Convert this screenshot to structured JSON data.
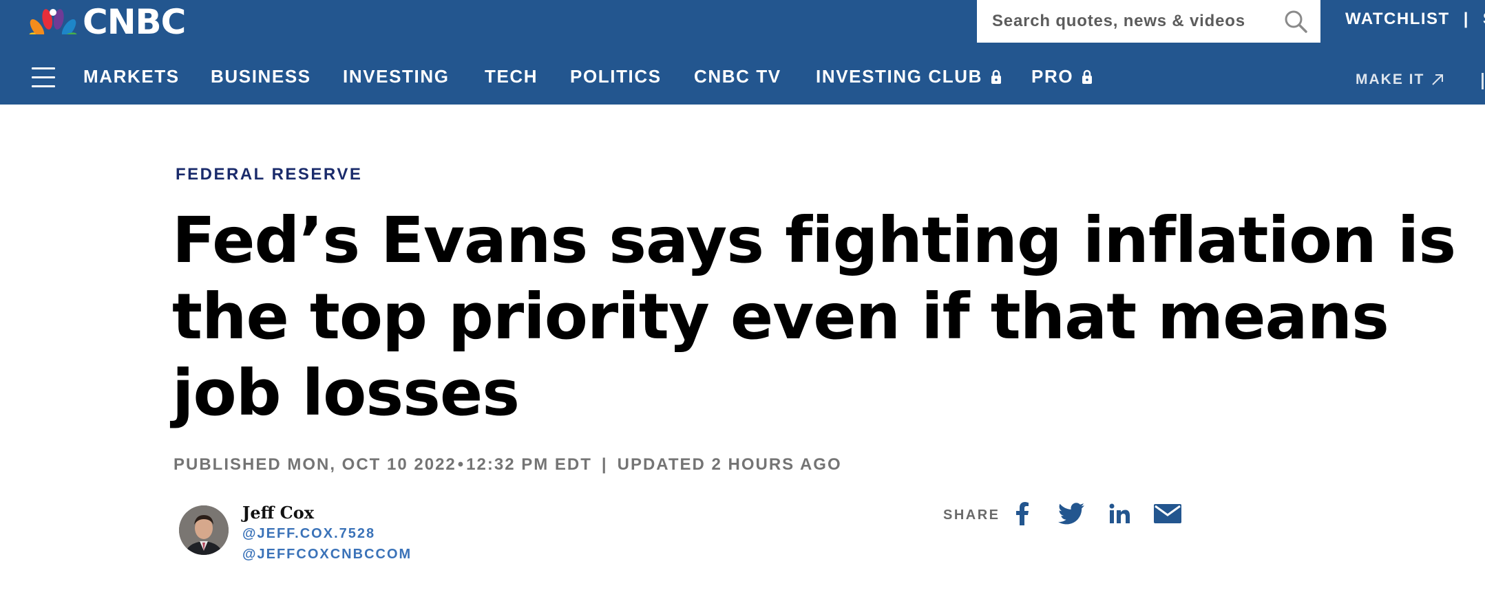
{
  "header": {
    "logo_text": "CNBC",
    "search_placeholder": "Search quotes, news & videos",
    "watchlist_label": "WATCHLIST",
    "separator": "|",
    "cut_off_label": "S",
    "nav_items": [
      {
        "label": "MARKETS"
      },
      {
        "label": "BUSINESS"
      },
      {
        "label": "INVESTING"
      },
      {
        "label": "TECH"
      },
      {
        "label": "POLITICS"
      },
      {
        "label": "CNBC TV"
      },
      {
        "label": "INVESTING CLUB",
        "icon": "lock-icon"
      },
      {
        "label": "PRO",
        "icon": "lock-icon"
      }
    ],
    "make_it_label": "MAKE IT",
    "make_it_icon": "external-arrow-icon"
  },
  "article": {
    "eyebrow": "FEDERAL RESERVE",
    "headline": "Fed’s Evans says fighting inflation is the top priority even if that means job losses",
    "published": "PUBLISHED MON, OCT 10 2022",
    "dot": "•",
    "time": "12:32 PM EDT",
    "separator": "|",
    "updated": "UPDATED 2 HOURS AGO"
  },
  "author": {
    "name": "Jeff Cox",
    "handle_1": "@JEFF.COX.7528",
    "handle_2": "@JEFFCOXCNBCCOM"
  },
  "share": {
    "label": "SHARE",
    "icons": [
      "facebook-icon",
      "twitter-icon",
      "linkedin-icon",
      "email-icon"
    ]
  },
  "colors": {
    "header_bg": "#23568f",
    "eyebrow": "#1a2b6b",
    "link": "#3a72b8",
    "share_icon": "#23568f",
    "meta": "#747474"
  }
}
